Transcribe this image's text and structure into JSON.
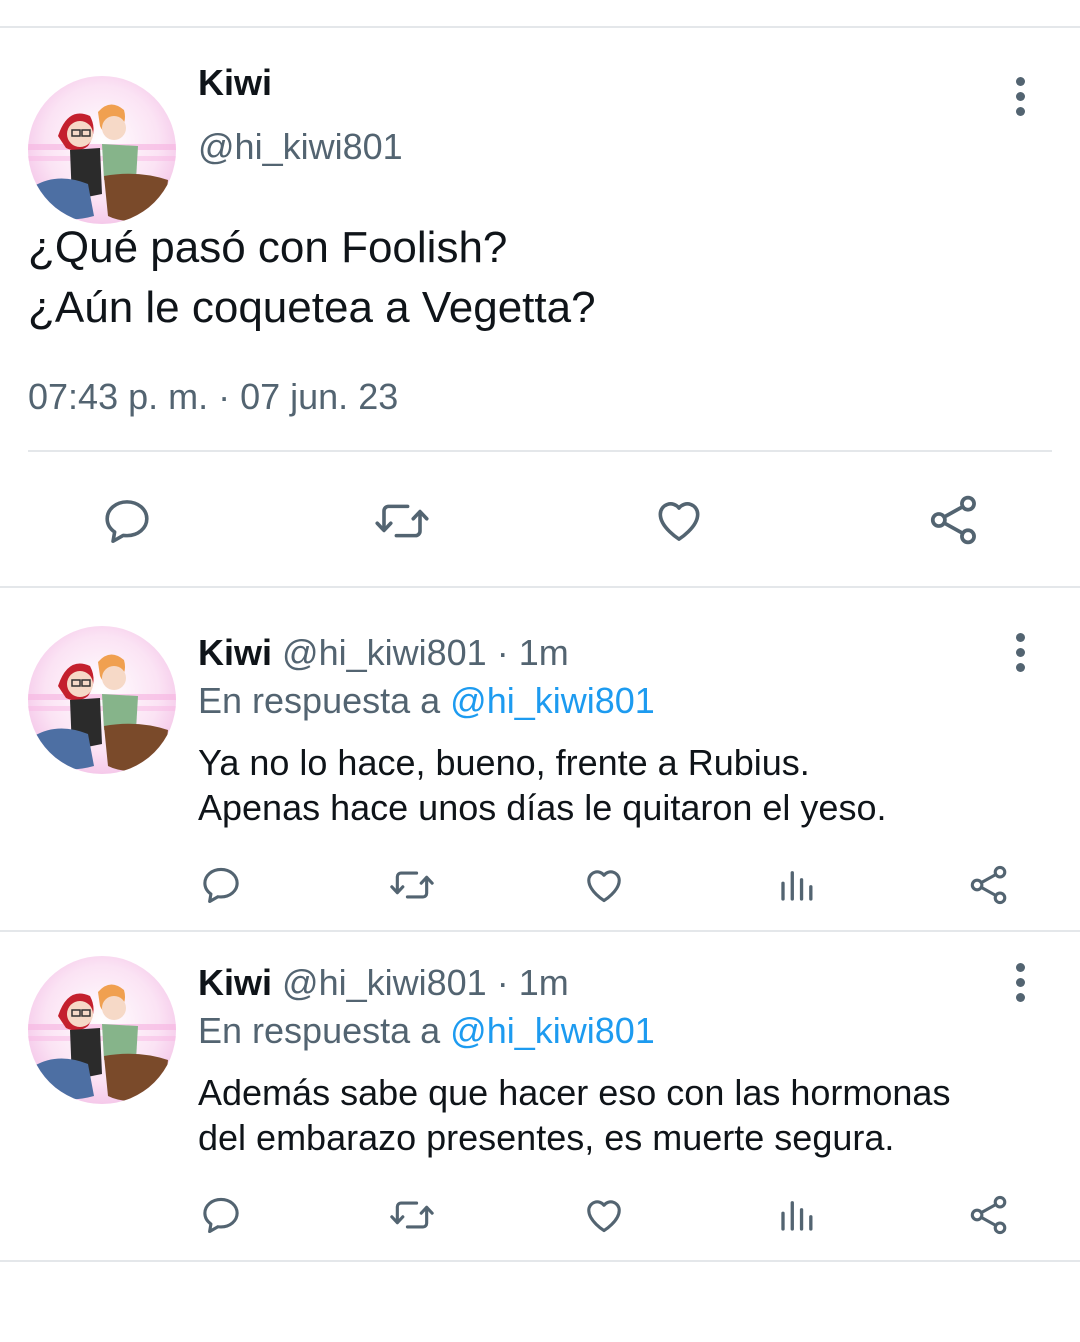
{
  "main_tweet": {
    "display_name": "Kiwi",
    "handle": "@hi_kiwi801",
    "text_lines": [
      "¿Qué pasó con Foolish?",
      "¿Aún le coquetea a Vegetta?"
    ],
    "timestamp": "07:43 p. m. · 07 jun. 23",
    "actions": [
      "reply-icon",
      "retweet-icon",
      "like-icon",
      "share-icon"
    ]
  },
  "replies": [
    {
      "display_name": "Kiwi",
      "handle": "@hi_kiwi801",
      "separator": "·",
      "time": "1m",
      "reply_prefix": "En respuesta a",
      "reply_to": "@hi_kiwi801",
      "text_lines": [
        "Ya no lo hace, bueno, frente a Rubius.",
        "Apenas hace unos días le quitaron el yeso."
      ],
      "actions": [
        "reply-icon",
        "retweet-icon",
        "like-icon",
        "views-icon",
        "share-icon"
      ]
    },
    {
      "display_name": "Kiwi",
      "handle": "@hi_kiwi801",
      "separator": "·",
      "time": "1m",
      "reply_prefix": "En respuesta a",
      "reply_to": "@hi_kiwi801",
      "text_lines": [
        "Además sabe que hacer eso con las hormonas",
        "del embarazo presentes, es muerte segura."
      ],
      "actions": [
        "reply-icon",
        "retweet-icon",
        "like-icon",
        "views-icon",
        "share-icon"
      ]
    }
  ],
  "colors": {
    "text": "#0f1419",
    "secondary": "#536471",
    "link": "#1d9bf0",
    "divider": "#e4e7ea"
  }
}
